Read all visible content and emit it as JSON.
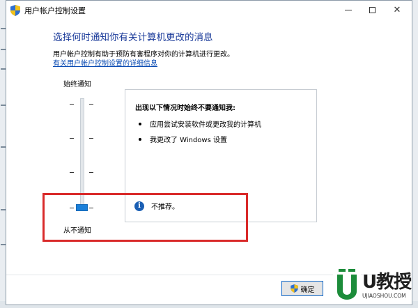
{
  "window": {
    "title": "用户帐户控制设置",
    "minimize_label": "",
    "maximize_label": "",
    "close_label": "✕"
  },
  "main": {
    "heading": "选择何时通知你有关计算机更改的消息",
    "description": "用户帐户控制有助于预防有害程序对你的计算机进行更改。",
    "link": "有关用户帐户控制设置的详细信息"
  },
  "slider": {
    "top_label": "始终通知",
    "bottom_label": "从不通知",
    "levels": 4,
    "selected_level": 1
  },
  "info_panel": {
    "title": "出现以下情况时始终不要通知我:",
    "bullets": [
      "应用尝试安装软件或更改我的计算机",
      "我更改了 Windows 设置"
    ],
    "footer": "不推荐。"
  },
  "footer": {
    "ok_label": "确定"
  },
  "watermark": {
    "brand": "U教授",
    "site": "UJIAOSHOU.COM"
  },
  "colors": {
    "heading": "#1b3b9a",
    "highlight": "#d92a2a",
    "slider_thumb": "#1a7fd9",
    "info_icon": "#1a5fb4"
  }
}
